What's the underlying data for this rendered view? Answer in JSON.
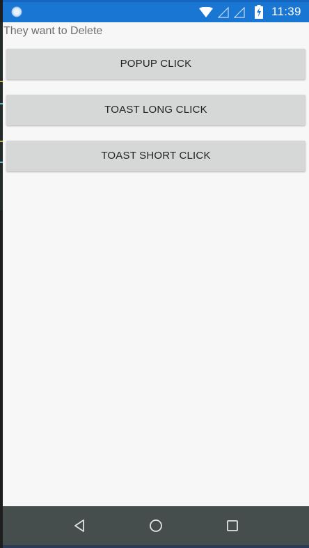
{
  "status_bar": {
    "time": "11:39",
    "background": "#1976d2"
  },
  "main": {
    "label": "They want to Delete",
    "buttons": [
      {
        "label": "POPUP CLICK"
      },
      {
        "label": "TOAST LONG CLICK"
      },
      {
        "label": "TOAST SHORT CLICK"
      }
    ]
  },
  "nav_bar": {
    "icons": [
      "back-icon",
      "home-icon",
      "recents-icon"
    ],
    "background": "#454d4d"
  }
}
